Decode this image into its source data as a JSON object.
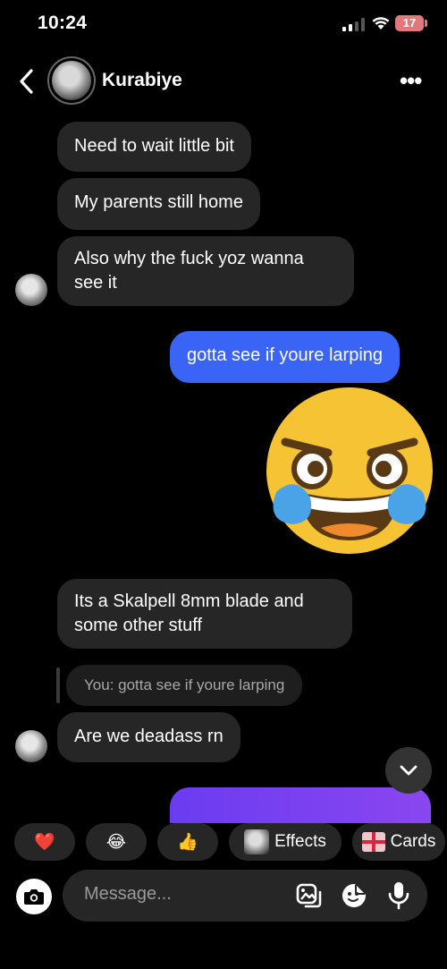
{
  "status_bar": {
    "time": "10:24",
    "battery": "17"
  },
  "header": {
    "contact_name": "Kurabiye"
  },
  "messages": [
    {
      "from": "them",
      "text": "Need to wait little bit"
    },
    {
      "from": "them",
      "text": "My parents still home"
    },
    {
      "from": "them",
      "text": "Also why the fuck yoz wanna\nsee it"
    },
    {
      "from": "me",
      "text": "gotta see if youre larping"
    },
    {
      "from": "me",
      "emoji": "rolling-on-floor-laughing"
    },
    {
      "from": "them",
      "text": "Its a Skalpell 8mm blade and\nsome other stuff"
    },
    {
      "from": "them",
      "reply_to": "You: gotta see if youre larping",
      "text": "Are we deadass rn"
    }
  ],
  "quick_reactions": [
    {
      "icon": "heart",
      "glyph": "❤️"
    },
    {
      "icon": "tears-of-joy",
      "glyph": "😂"
    },
    {
      "icon": "thumbs-up",
      "glyph": "👍"
    },
    {
      "label": "Effects"
    },
    {
      "label": "Cards"
    }
  ],
  "composer": {
    "placeholder": "Message..."
  }
}
